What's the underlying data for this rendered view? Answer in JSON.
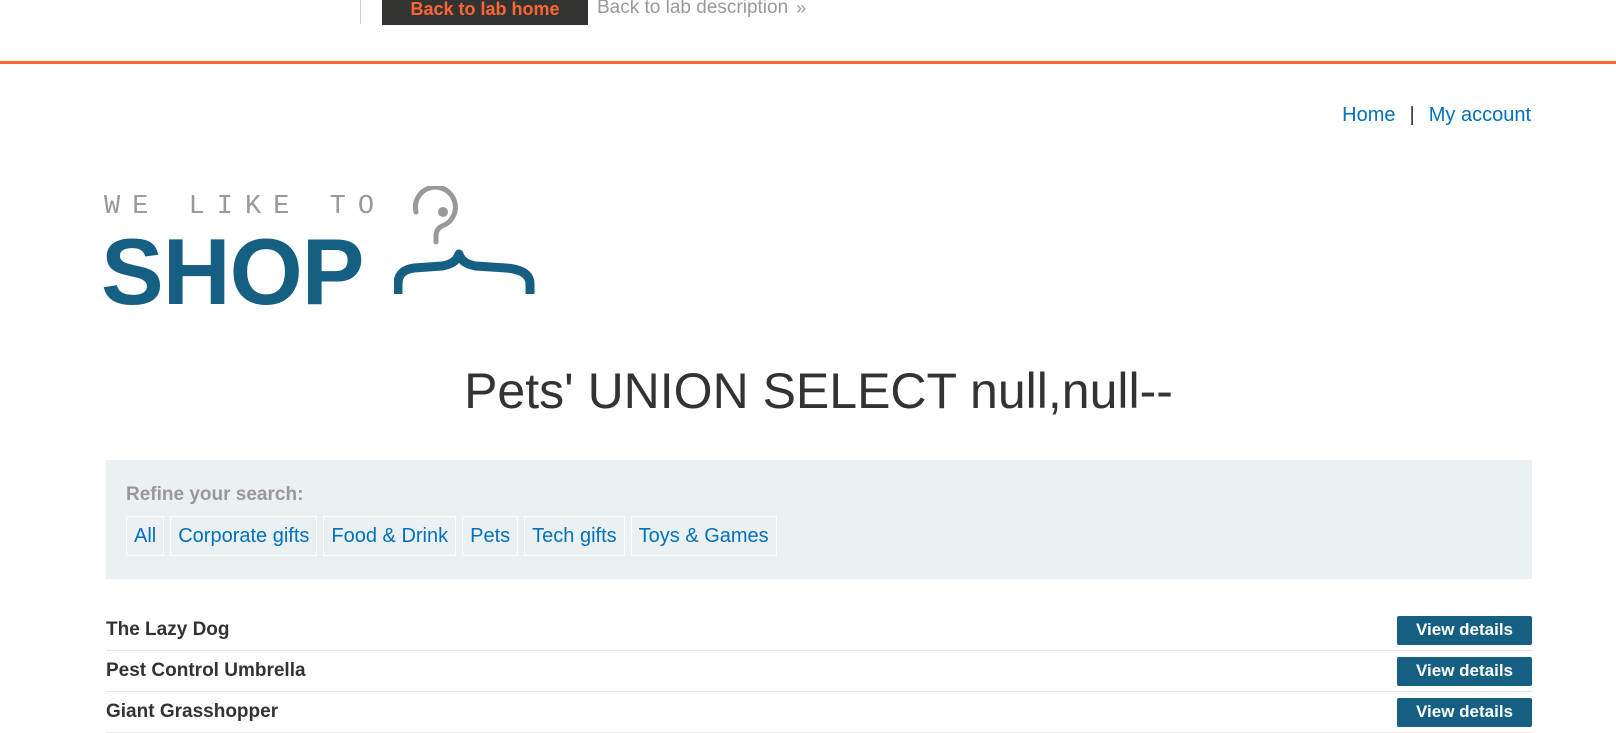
{
  "banner": {
    "back_home_label": "Back to lab home",
    "back_description_label": "Back to lab description"
  },
  "top_nav": {
    "home_label": "Home",
    "separator": "|",
    "my_account_label": "My account"
  },
  "logo": {
    "tagline": "WE LIKE TO",
    "shop": "SHOP"
  },
  "heading": "Pets' UNION SELECT null,null--",
  "filters": {
    "refine_label": "Refine your search:",
    "categories": [
      "All",
      "Corporate gifts",
      "Food & Drink",
      "Pets",
      "Tech gifts",
      "Toys & Games"
    ]
  },
  "products": [
    {
      "name": "The Lazy Dog",
      "button": "View details"
    },
    {
      "name": "Pest Control Umbrella",
      "button": "View details"
    },
    {
      "name": "Giant Grasshopper",
      "button": "View details"
    }
  ],
  "colors": {
    "accent_orange": "#ff6633",
    "brand_blue": "#155f82",
    "link_blue": "#0071bc",
    "filter_bg": "#ebf0f2"
  }
}
